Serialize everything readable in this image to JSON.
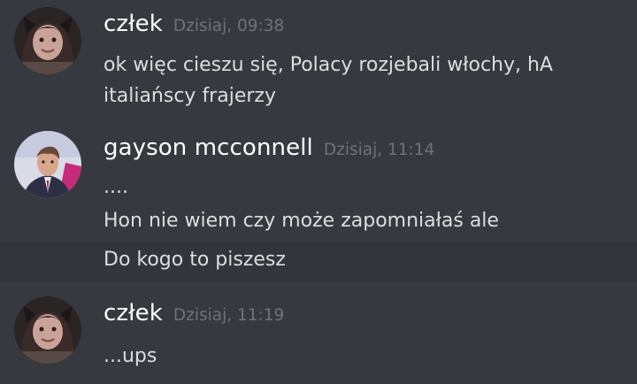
{
  "colors": {
    "background": "#36393f",
    "hover_background": "#32353b",
    "username": "#ffffff",
    "timestamp": "#6f7278",
    "message_text": "#dcddde"
  },
  "messages": [
    {
      "avatar_icon": "cat-ears-girl-avatar-icon",
      "username": "człek",
      "timestamp": "Dzisiaj, 09:38",
      "lines": [
        "ok więc cieszu się, Polacy rozjebali włochy, hA",
        "italiańscy frajerzy"
      ]
    },
    {
      "avatar_icon": "man-in-suit-avatar-icon",
      "username": "gayson mcconnell",
      "timestamp": "Dzisiaj, 11:14",
      "lines": [
        "....",
        "Hon nie wiem czy może zapomniałaś ale",
        "Do kogo to piszesz"
      ]
    },
    {
      "avatar_icon": "cat-ears-girl-avatar-icon",
      "username": "człek",
      "timestamp": "Dzisiaj, 11:19",
      "lines": [
        "...ups"
      ]
    }
  ]
}
